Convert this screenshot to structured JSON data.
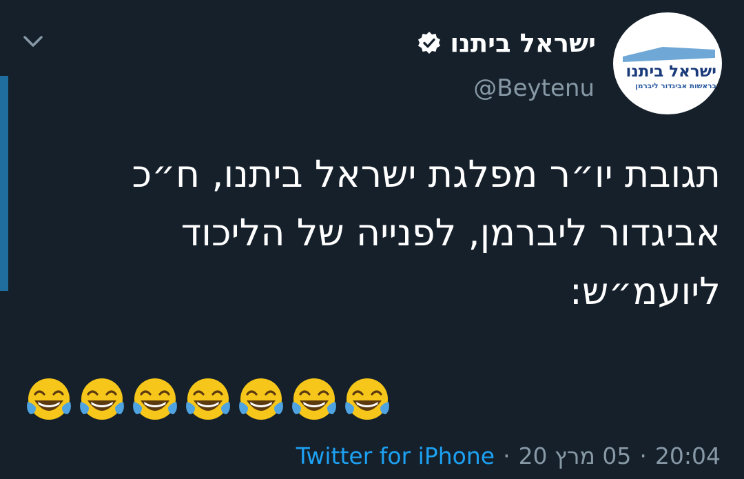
{
  "tweet": {
    "author": {
      "name": "ישראל ביתנו",
      "handle": "@Beytenu",
      "verified": true,
      "avatar_logo": {
        "title": "ישראל ביתנו",
        "subtitle": "בראשות אביגדור ליברמן"
      }
    },
    "text_lines": [
      "תגובת יו״ר מפלגת ישראל ביתנו, ח״כ",
      "אביגדור ליברמן, לפנייה של הליכוד",
      "ליועמ״ש:"
    ],
    "emoji": {
      "name": "face-with-tears-of-joy",
      "count": 7
    },
    "meta": {
      "time": "20:04",
      "date": "05 מרץ 20",
      "source": "Twitter for iPhone",
      "separator": "·"
    }
  },
  "colors": {
    "background": "#15202b",
    "accent_bar": "#1f6e9e",
    "link": "#1da1f2",
    "secondary_text": "#8899a6"
  }
}
